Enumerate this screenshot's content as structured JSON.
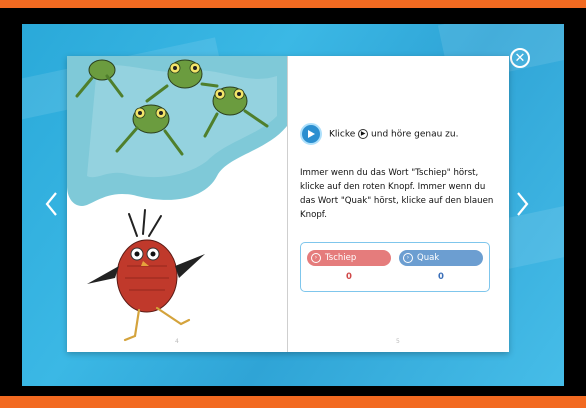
{
  "nav": {
    "close_icon": "close-icon",
    "prev_icon": "chevron-left-icon",
    "next_icon": "chevron-right-icon"
  },
  "left_page": {
    "illustration_top": "frogs-in-pond-illustration",
    "illustration_bottom": "dancing-bird-illustration",
    "page_number": "4"
  },
  "right_page": {
    "instruction_text": "Klicke",
    "instruction_glyph": "▶",
    "instruction_suffix": "und höre genau zu.",
    "body_text": "Immer wenn du das Wort \"Tschiep\" hörst, klicke auf den roten Knopf. Immer wenn du das Wort \"Quak\" hörst, klicke auf den blauen Knopf.",
    "page_number": "5"
  },
  "score": {
    "tschiep_label": "Tschiep",
    "tschiep_value": "0",
    "quak_label": "Quak",
    "quak_value": "0",
    "button_glyph": "›"
  },
  "colors": {
    "frame_orange": "#f26a21",
    "stage_blue": "#2aa9d9",
    "play_blue": "#2b8fd0",
    "tschiep_red": "#e57c7c",
    "quak_blue": "#6c9ed1"
  }
}
